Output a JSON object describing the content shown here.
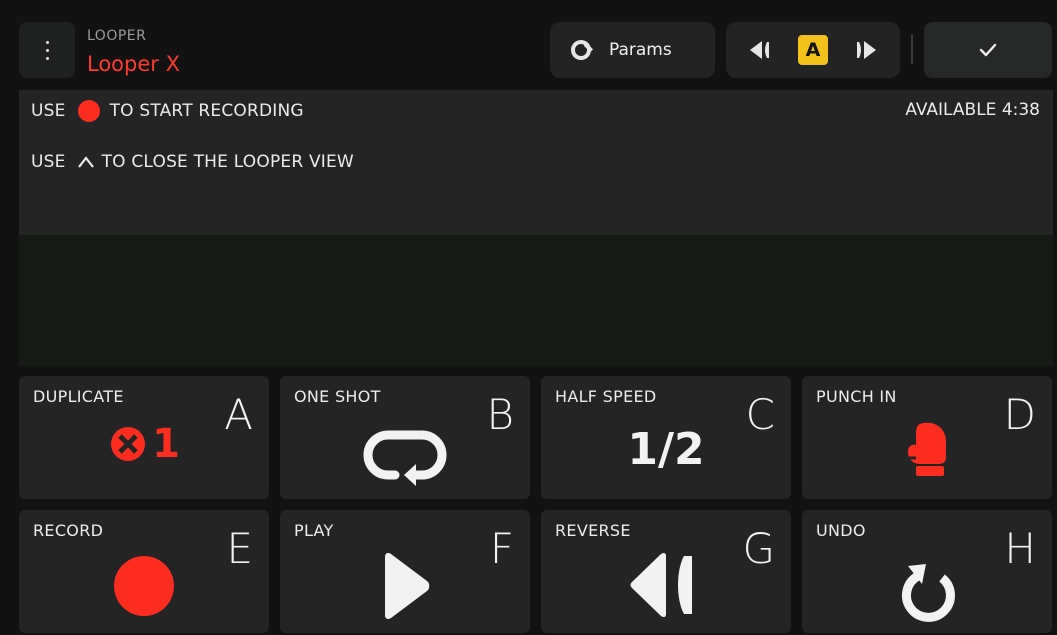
{
  "header": {
    "menu_icon": "vertical-dots-icon",
    "subtitle": "LOOPER",
    "title": "Looper X",
    "params_label": "Params",
    "params_icon": "knob-icon",
    "nav": {
      "prev_icon": "skip-back-icon",
      "badge": "A",
      "next_icon": "skip-forward-icon"
    },
    "confirm_icon": "checkmark-icon"
  },
  "info": {
    "line1_prefix": "USE",
    "line1_suffix": "TO START RECORDING",
    "line2_prefix": "USE",
    "line2_suffix": "TO CLOSE THE LOOPER VIEW",
    "available": "AVAILABLE 4:38"
  },
  "pads": [
    {
      "label": "DUPLICATE",
      "letter": "A",
      "icon": "multiply-x1-icon",
      "icon_text": "1"
    },
    {
      "label": "ONE SHOT",
      "letter": "B",
      "icon": "loop-icon"
    },
    {
      "label": "HALF SPEED",
      "letter": "C",
      "icon": "half-icon",
      "icon_text": "1/2"
    },
    {
      "label": "PUNCH IN",
      "letter": "D",
      "icon": "boxing-glove-icon"
    },
    {
      "label": "RECORD",
      "letter": "E",
      "icon": "record-icon"
    },
    {
      "label": "PLAY",
      "letter": "F",
      "icon": "play-icon"
    },
    {
      "label": "REVERSE",
      "letter": "G",
      "icon": "reverse-icon"
    },
    {
      "label": "UNDO",
      "letter": "H",
      "icon": "undo-icon"
    }
  ],
  "colors": {
    "accent_red": "#ff2d1f",
    "badge_yellow": "#f2c11c",
    "panel": "#242424",
    "background": "#121212"
  }
}
